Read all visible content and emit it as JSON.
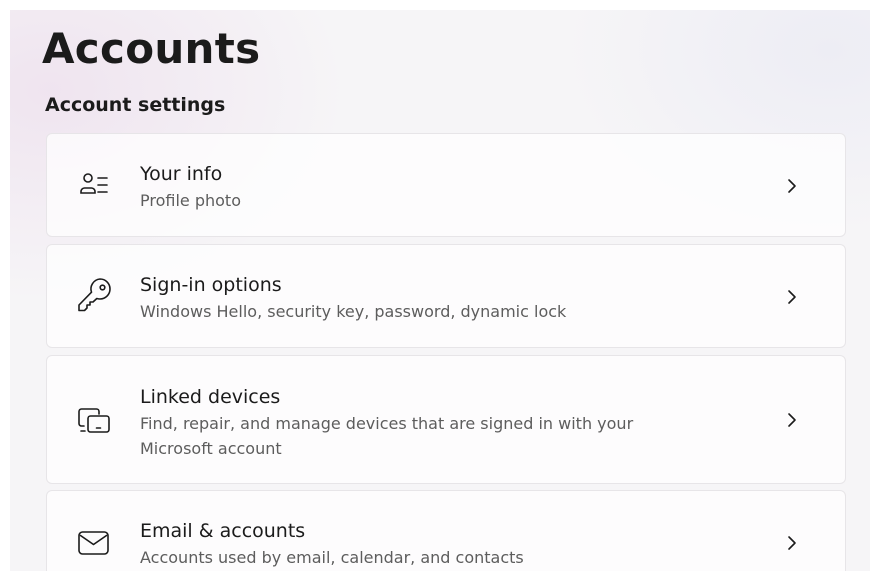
{
  "page": {
    "title": "Accounts",
    "section_title": "Account settings"
  },
  "cards": [
    {
      "icon": "person-list-icon",
      "title": "Your info",
      "subtitle": "Profile photo"
    },
    {
      "icon": "key-icon",
      "title": "Sign-in options",
      "subtitle": "Windows Hello, security key, password, dynamic lock"
    },
    {
      "icon": "linked-devices-icon",
      "title": "Linked devices",
      "subtitle": "Find, repair, and manage devices that are signed in with your Microsoft account"
    },
    {
      "icon": "envelope-icon",
      "title": "Email & accounts",
      "subtitle": "Accounts used by email, calendar, and contacts"
    }
  ],
  "colors": {
    "background": "#f6f5f7",
    "card": "#ffffff",
    "text_primary": "#1b1b1b",
    "text_secondary": "#5d5d5d"
  }
}
